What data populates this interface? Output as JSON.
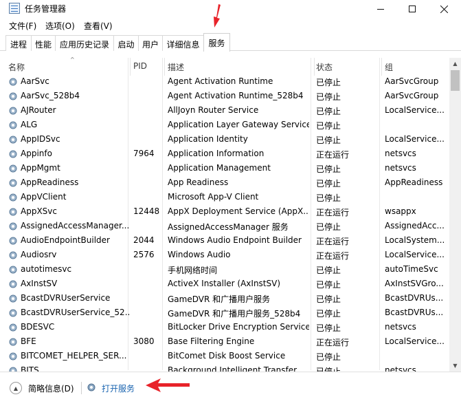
{
  "window": {
    "title": "任务管理器"
  },
  "menu": [
    {
      "label": "文件(F)"
    },
    {
      "label": "选项(O)"
    },
    {
      "label": "查看(V)"
    }
  ],
  "tabs": [
    {
      "label": "进程"
    },
    {
      "label": "性能"
    },
    {
      "label": "应用历史记录"
    },
    {
      "label": "启动"
    },
    {
      "label": "用户"
    },
    {
      "label": "详细信息"
    },
    {
      "label": "服务"
    }
  ],
  "active_tab": "服务",
  "columns": {
    "name": "名称",
    "pid": "PID",
    "desc": "描述",
    "status": "状态",
    "group": "组"
  },
  "services": [
    {
      "name": "AarSvc",
      "pid": "",
      "desc": "Agent Activation Runtime",
      "status": "已停止",
      "group": "AarSvcGroup"
    },
    {
      "name": "AarSvc_528b4",
      "pid": "",
      "desc": "Agent Activation Runtime_528b4",
      "status": "已停止",
      "group": "AarSvcGroup"
    },
    {
      "name": "AJRouter",
      "pid": "",
      "desc": "AllJoyn Router Service",
      "status": "已停止",
      "group": "LocalService..."
    },
    {
      "name": "ALG",
      "pid": "",
      "desc": "Application Layer Gateway Service",
      "status": "已停止",
      "group": ""
    },
    {
      "name": "AppIDSvc",
      "pid": "",
      "desc": "Application Identity",
      "status": "已停止",
      "group": "LocalService..."
    },
    {
      "name": "Appinfo",
      "pid": "7964",
      "desc": "Application Information",
      "status": "正在运行",
      "group": "netsvcs"
    },
    {
      "name": "AppMgmt",
      "pid": "",
      "desc": "Application Management",
      "status": "已停止",
      "group": "netsvcs"
    },
    {
      "name": "AppReadiness",
      "pid": "",
      "desc": "App Readiness",
      "status": "已停止",
      "group": "AppReadiness"
    },
    {
      "name": "AppVClient",
      "pid": "",
      "desc": "Microsoft App-V Client",
      "status": "已停止",
      "group": ""
    },
    {
      "name": "AppXSvc",
      "pid": "12448",
      "desc": "AppX Deployment Service (AppX...",
      "status": "正在运行",
      "group": "wsappx"
    },
    {
      "name": "AssignedAccessManager...",
      "pid": "",
      "desc": "AssignedAccessManager 服务",
      "status": "已停止",
      "group": "AssignedAcc..."
    },
    {
      "name": "AudioEndpointBuilder",
      "pid": "2044",
      "desc": "Windows Audio Endpoint Builder",
      "status": "正在运行",
      "group": "LocalSystem..."
    },
    {
      "name": "Audiosrv",
      "pid": "2576",
      "desc": "Windows Audio",
      "status": "正在运行",
      "group": "LocalService..."
    },
    {
      "name": "autotimesvc",
      "pid": "",
      "desc": "手机网络时间",
      "status": "已停止",
      "group": "autoTimeSvc"
    },
    {
      "name": "AxInstSV",
      "pid": "",
      "desc": "ActiveX Installer (AxInstSV)",
      "status": "已停止",
      "group": "AxInstSVGro..."
    },
    {
      "name": "BcastDVRUserService",
      "pid": "",
      "desc": "GameDVR 和广播用户服务",
      "status": "已停止",
      "group": "BcastDVRUs..."
    },
    {
      "name": "BcastDVRUserService_52...",
      "pid": "",
      "desc": "GameDVR 和广播用户服务_528b4",
      "status": "已停止",
      "group": "BcastDVRUs..."
    },
    {
      "name": "BDESVC",
      "pid": "",
      "desc": "BitLocker Drive Encryption Service",
      "status": "已停止",
      "group": "netsvcs"
    },
    {
      "name": "BFE",
      "pid": "3080",
      "desc": "Base Filtering Engine",
      "status": "正在运行",
      "group": "LocalService..."
    },
    {
      "name": "BITCOMET_HELPER_SER...",
      "pid": "",
      "desc": "BitComet Disk Boost Service",
      "status": "已停止",
      "group": ""
    },
    {
      "name": "BITS",
      "pid": "",
      "desc": "Background Intelligent Transfer...",
      "status": "已停止",
      "group": "netsvcs"
    }
  ],
  "footer": {
    "fewer_details": "简略信息(D)",
    "open_services": "打开服务"
  },
  "colors": {
    "annotation_arrow": "#e8232a",
    "link": "#1a64b0"
  },
  "icons": {
    "service": "gear-icon",
    "window_icon": "task-manager-icon"
  }
}
